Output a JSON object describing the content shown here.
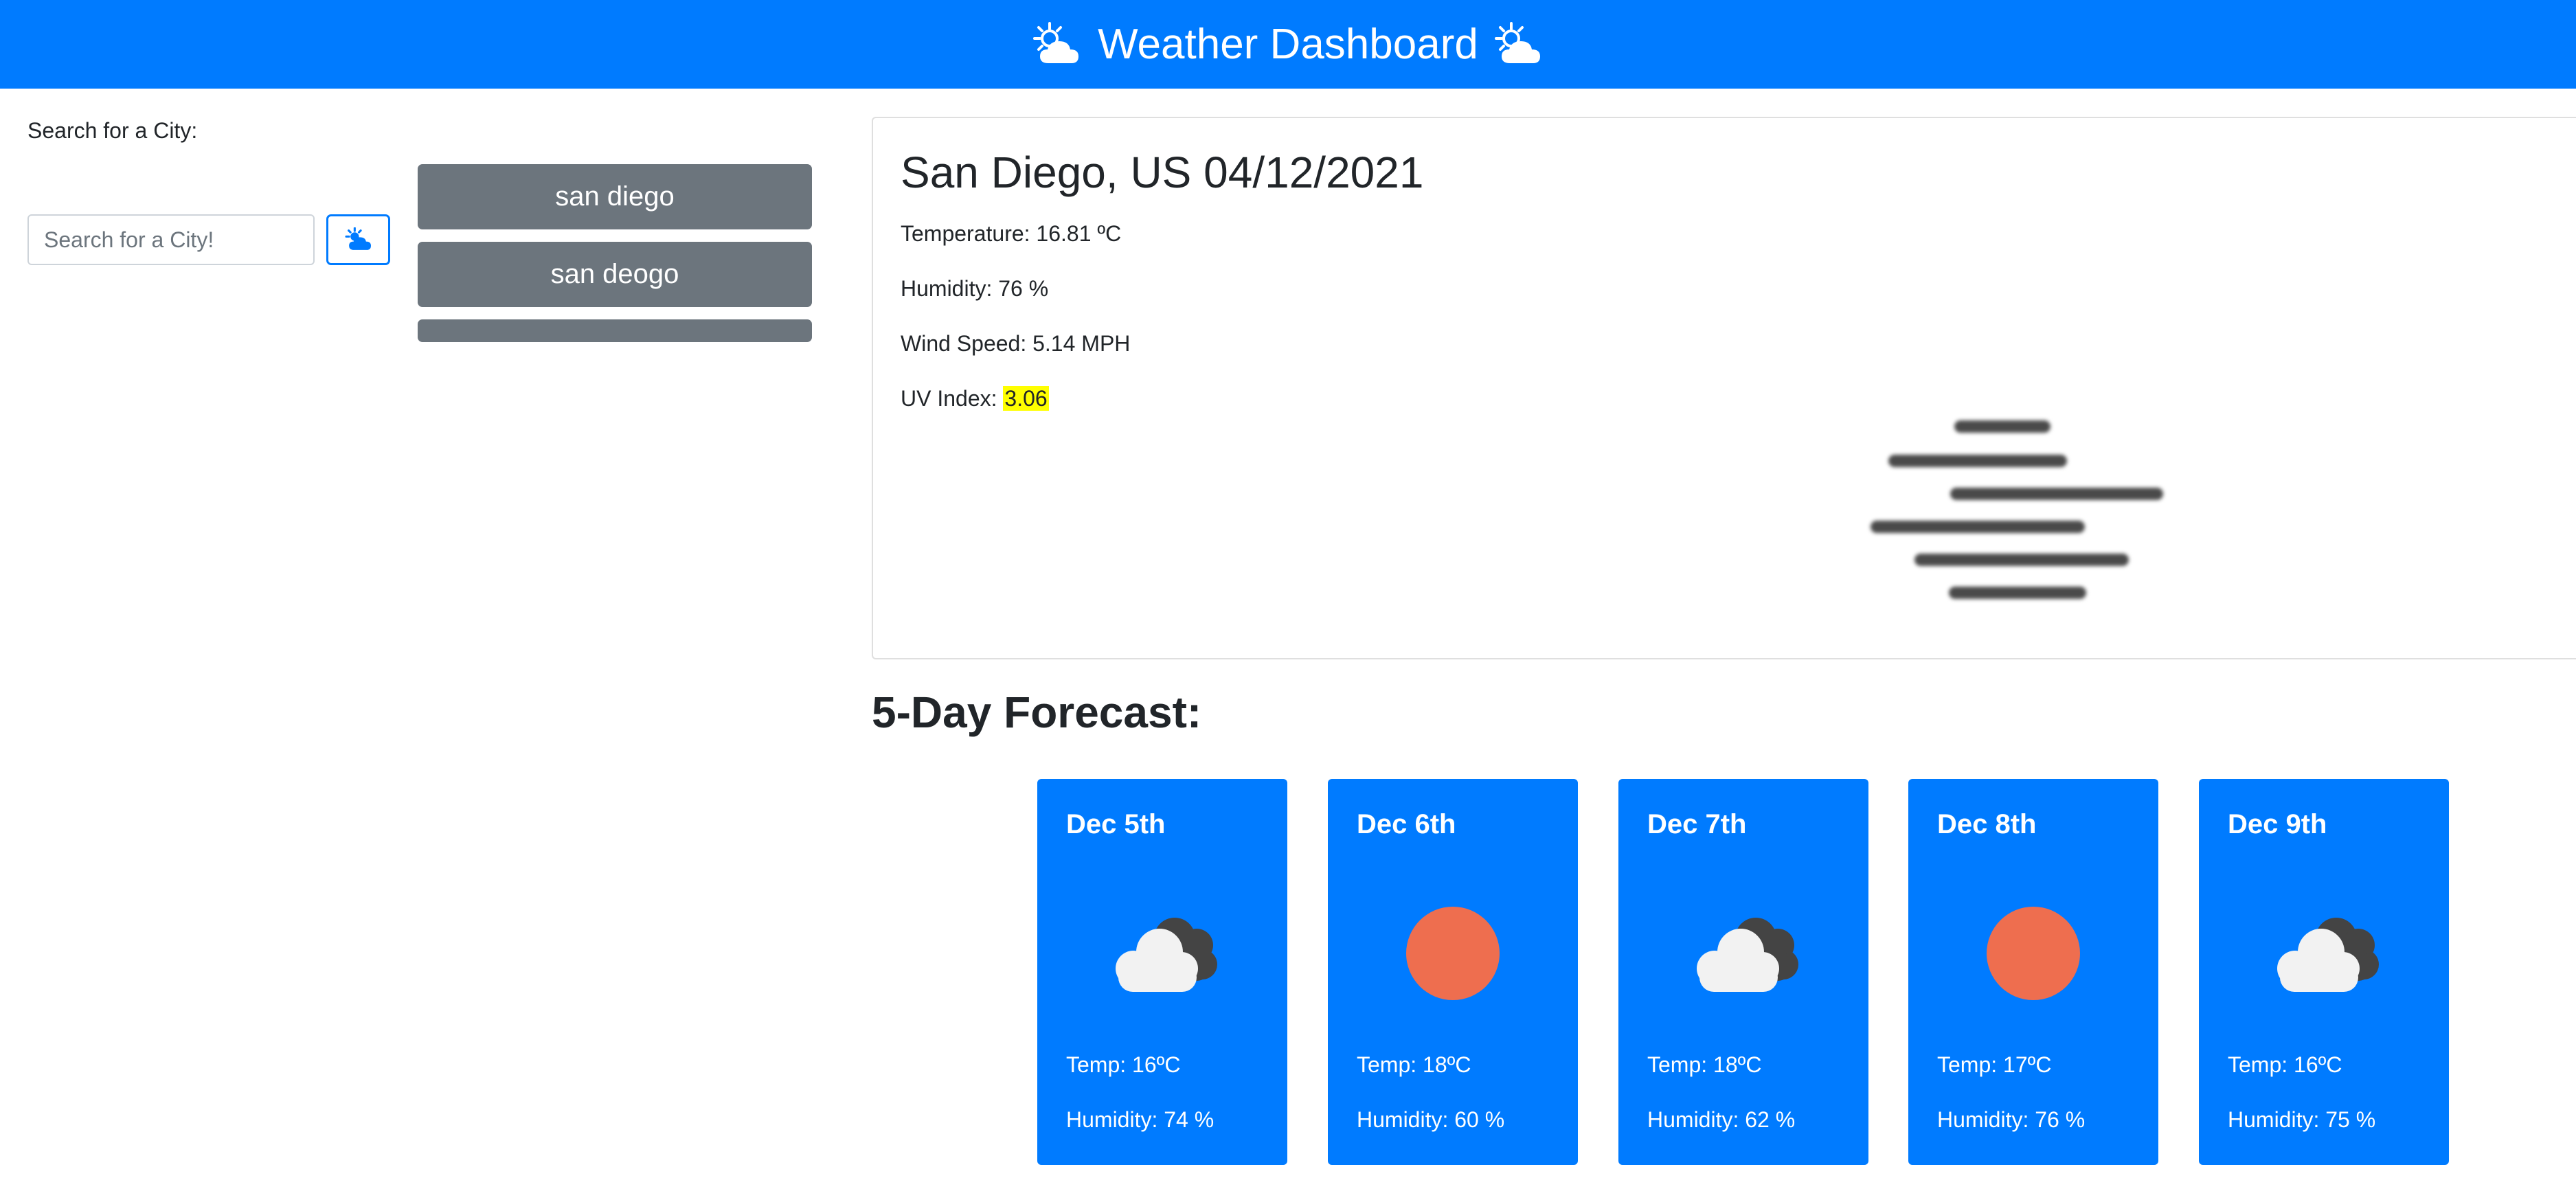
{
  "header": {
    "title": "Weather Dashboard",
    "left_icon": "sun-cloud-icon",
    "right_icon": "sun-cloud-icon"
  },
  "search": {
    "label": "Search for a City:",
    "placeholder": "Search for a City!",
    "value": "",
    "button_icon": "sun-cloud-icon"
  },
  "history": [
    "san diego",
    "san deogo",
    ""
  ],
  "current": {
    "title": "San Diego, US 04/12/2021",
    "temperature": "Temperature: 16.81 ºC",
    "humidity": "Humidity: 76 %",
    "wind": "Wind Speed: 5.14 MPH",
    "uv_label": "UV Index: ",
    "uv_value": "3.06",
    "uv_color": "#ffff00",
    "icon": "mist-icon"
  },
  "forecast": {
    "heading": "5-Day Forecast:",
    "days": [
      {
        "date": "Dec 5th",
        "icon": "broken-clouds-icon",
        "temp": "Temp: 16ºC",
        "humidity": "Humidity: 74 %"
      },
      {
        "date": "Dec 6th",
        "icon": "clear-sun-icon",
        "temp": "Temp: 18ºC",
        "humidity": "Humidity: 60 %"
      },
      {
        "date": "Dec 7th",
        "icon": "broken-clouds-icon",
        "temp": "Temp: 18ºC",
        "humidity": "Humidity: 62 %"
      },
      {
        "date": "Dec 8th",
        "icon": "clear-sun-icon",
        "temp": "Temp: 17ºC",
        "humidity": "Humidity: 76 %"
      },
      {
        "date": "Dec 9th",
        "icon": "broken-clouds-icon",
        "temp": "Temp: 16ºC",
        "humidity": "Humidity: 75 %"
      }
    ]
  },
  "colors": {
    "primary": "#007bff",
    "secondary": "#6c757d",
    "sun": "#ee6e4f",
    "cloud": "#f2f2f2",
    "cloud_dark": "#444444"
  }
}
